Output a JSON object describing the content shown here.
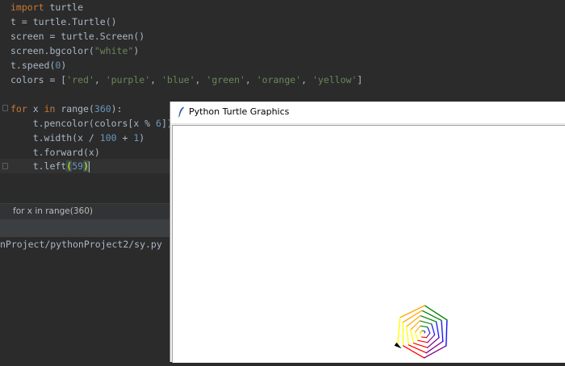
{
  "editor": {
    "lines": {
      "l1": {
        "kw": "import",
        "rest": " turtle"
      },
      "l2": "t = turtle.Turtle()",
      "l3": "screen = turtle.Screen()",
      "l4": {
        "pre": "screen.bgcolor(",
        "str": "\"white\"",
        "post": ")"
      },
      "l5": {
        "pre": "t.speed(",
        "num": "0",
        "post": ")"
      },
      "l6": {
        "pre": "colors = [",
        "items": [
          "'red'",
          "'purple'",
          "'blue'",
          "'green'",
          "'orange'",
          "'yellow'"
        ],
        "sep": ", ",
        "post": "]"
      },
      "l8": {
        "kw1": "for",
        "mid1": " x ",
        "kw2": "in",
        "mid2": " range(",
        "num": "360",
        "post": "):"
      },
      "l9": {
        "pre": "    t.pencolor(colors[x % ",
        "num": "6",
        "post": "])"
      },
      "l10": {
        "pre": "    t.width(x / ",
        "num1": "100",
        "mid": " + ",
        "num2": "1",
        "post": ")"
      },
      "l11": "    t.forward(x)",
      "l12": {
        "pre": "    t.left",
        "open": "(",
        "num": "59",
        "close": ")"
      }
    }
  },
  "breadcrumb": {
    "text": "for x in range(360)"
  },
  "terminal": {
    "path_line": "nProject/pythonProject2/sy.py"
  },
  "turtle_window": {
    "title": "Python Turtle Graphics",
    "canvas_bg": "#ffffff",
    "pen_colors": [
      "red",
      "purple",
      "blue",
      "green",
      "orange",
      "yellow"
    ],
    "left_angle": 59,
    "width_divisor": 100
  },
  "theme": {
    "editor_bg": "#2b2b2b",
    "keyword": "#cc7832",
    "string": "#6a8759",
    "number": "#6897bb",
    "text": "#a9b7c6"
  }
}
